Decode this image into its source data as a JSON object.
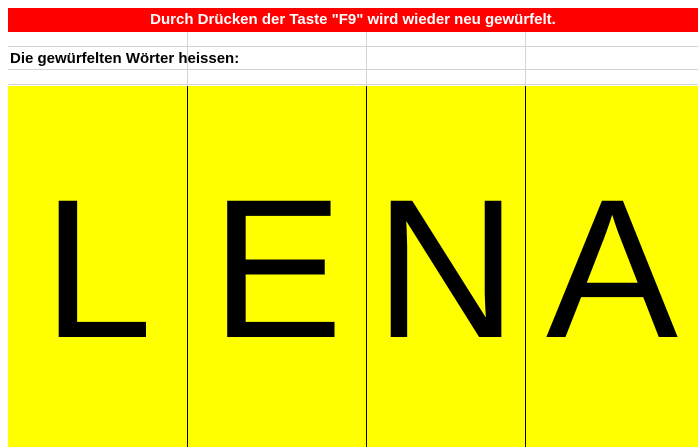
{
  "instruction_banner": "Durch Drücken der Taste \"F9\" wird wieder neu gewürfelt.",
  "caption": "Die gewürfelten Wörter heissen:",
  "letters": [
    "L",
    "E",
    "N",
    "A"
  ],
  "colors": {
    "banner_background": "#ff0000",
    "banner_text": "#ffffff",
    "tile_background": "#ffff00",
    "letter": "#000000"
  }
}
